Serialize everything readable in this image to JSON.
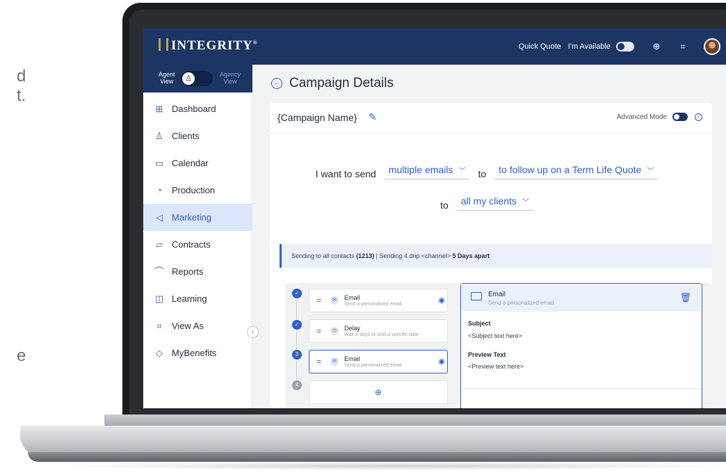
{
  "left_fragments": [
    "d",
    "t.",
    "e"
  ],
  "header": {
    "logo_text": "INTEGRITY",
    "logo_reg": "®",
    "quick_quote": "Quick Quote",
    "availability_label": "I'm Available",
    "icons": [
      "plus-circle-icon",
      "scan-user-icon",
      "avatar"
    ]
  },
  "view_switch": {
    "agent_line1": "Agent",
    "agent_line2": "View",
    "agency_line1": "Agency",
    "agency_line2": "View"
  },
  "sidebar": {
    "items": [
      {
        "label": "Dashboard",
        "icon": "dashboard-icon",
        "glyph": "⊞"
      },
      {
        "label": "Clients",
        "icon": "person-icon",
        "glyph": "♙"
      },
      {
        "label": "Calendar",
        "icon": "calendar-icon",
        "glyph": "▭"
      },
      {
        "label": "Production",
        "icon": "production-icon",
        "glyph": "◔"
      },
      {
        "label": "Marketing",
        "icon": "megaphone-icon",
        "glyph": "◁"
      },
      {
        "label": "Contracts",
        "icon": "contract-icon",
        "glyph": "▱"
      },
      {
        "label": "Reports",
        "icon": "chart-icon",
        "glyph": "⌒"
      },
      {
        "label": "Learning",
        "icon": "book-icon",
        "glyph": "◫"
      },
      {
        "label": "View As",
        "icon": "view-as-icon",
        "glyph": "⌗"
      },
      {
        "label": "MyBenefits",
        "icon": "tag-icon",
        "glyph": "◇"
      }
    ],
    "active": "Marketing"
  },
  "main": {
    "title": "Campaign Details",
    "campaign_name": "{Campaign Name}",
    "advanced_mode": "Advanced Mode",
    "sentence": {
      "prefix": "I want to send",
      "option1": "multiple emails",
      "to1": "to",
      "option2": "to follow up on a Term Life Quote",
      "to2": "to",
      "option3": "all my clients"
    },
    "banner": {
      "part1": "Sending to all contacts",
      "count": "(1213)",
      "part2": "| Sending 4 drip <channel>",
      "interval": "5 Days apart"
    },
    "steps": [
      {
        "number": "",
        "title": "Email",
        "subtitle": "Send a personalized email",
        "icon": "mail-icon",
        "done": true
      },
      {
        "number": "",
        "title": "Delay",
        "subtitle": "Wait X days or until a specific date",
        "icon": "clock-icon",
        "done": true
      },
      {
        "number": "3",
        "title": "Email",
        "subtitle": "Send a personalized email",
        "icon": "mail-icon",
        "done": false
      },
      {
        "number": "4"
      }
    ],
    "detail": {
      "title": "Email",
      "subtitle": "Send a personalized email",
      "subject_label": "Subject",
      "subject_value": "<Subject text here>",
      "preview_label": "Preview Text",
      "preview_value": "<Preview text here>"
    }
  }
}
